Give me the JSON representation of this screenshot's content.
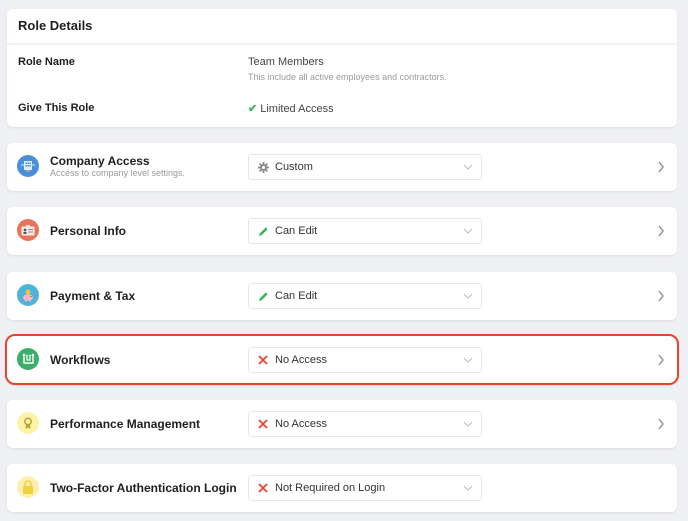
{
  "role_details": {
    "header": "Role Details",
    "role_name_label": "Role Name",
    "role_name_value": "Team Members",
    "role_name_description": "This include all active employees and contractors.",
    "give_role_label": "Give This Role",
    "give_role_value": "Limited Access",
    "give_role_icon": "check-icon"
  },
  "permissions": [
    {
      "title": "Company Access",
      "subtitle": "Access to company level settings.",
      "icon": "building-icon",
      "icon_bg": "#4a90d9",
      "value": "Custom",
      "value_icon": "gear-icon",
      "highlighted": false
    },
    {
      "title": "Personal Info",
      "subtitle": "",
      "icon": "id-card-icon",
      "icon_bg": "#e8735a",
      "value": "Can Edit",
      "value_icon": "pencil-icon",
      "highlighted": false
    },
    {
      "title": "Payment & Tax",
      "subtitle": "",
      "icon": "piggy-bank-icon",
      "icon_bg": "#4fb3d9",
      "value": "Can Edit",
      "value_icon": "pencil-icon",
      "highlighted": false
    },
    {
      "title": "Workflows",
      "subtitle": "",
      "icon": "workflow-icon",
      "icon_bg": "#3dae6a",
      "value": "No Access",
      "value_icon": "x-icon",
      "highlighted": true
    },
    {
      "title": "Performance Management",
      "subtitle": "",
      "icon": "award-icon",
      "icon_bg": "#fbf3a8",
      "value": "No Access",
      "value_icon": "x-icon",
      "highlighted": false
    },
    {
      "title": "Two-Factor Authentication Login",
      "subtitle": "",
      "icon": "lock-icon",
      "icon_bg": "#fbf0b0",
      "value": "Not Required on Login",
      "value_icon": "x-icon",
      "highlighted": false
    }
  ],
  "colors": {
    "highlight": "#e5452d",
    "check": "#3bb55c",
    "edit": "#3bb55c",
    "deny": "#e5452d"
  }
}
